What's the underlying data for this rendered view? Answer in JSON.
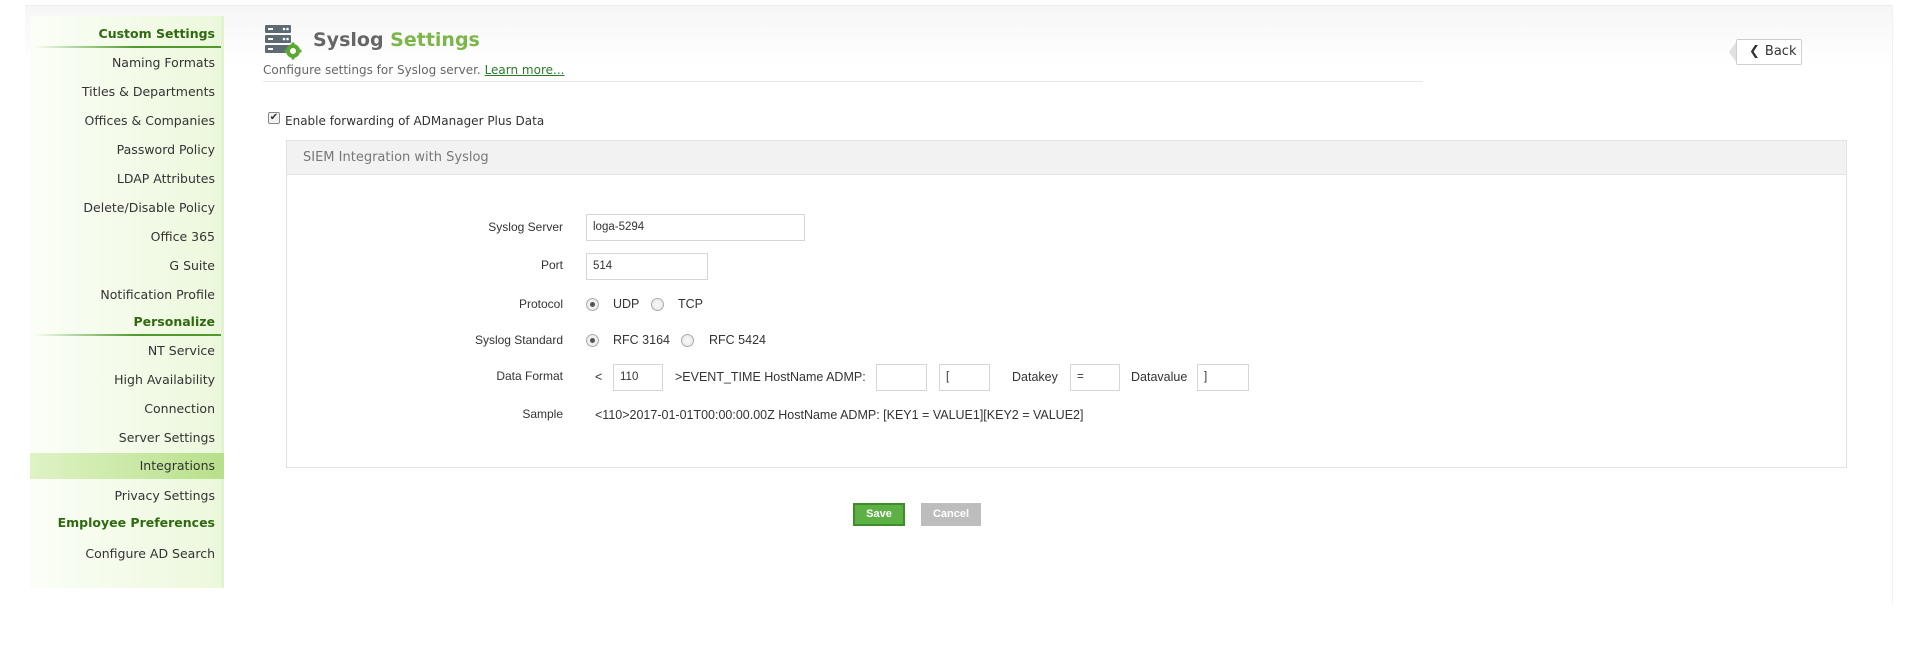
{
  "sidebar": {
    "sections": [
      {
        "heading": "Custom Settings",
        "items": [
          "Naming Formats",
          "Titles & Departments",
          "Offices & Companies",
          "Password Policy",
          "LDAP Attributes",
          "Delete/Disable Policy",
          "Office 365",
          "G Suite",
          "Notification Profile"
        ]
      },
      {
        "heading": "Personalize",
        "items": [
          "NT Service",
          "High Availability",
          "Connection",
          "Server Settings",
          "Integrations",
          "Privacy Settings"
        ]
      },
      {
        "heading": "Employee Preferences",
        "items": [
          "Configure AD Search"
        ]
      }
    ],
    "active_item": "Integrations",
    "accent_color": "#2f6a10"
  },
  "header": {
    "title_part1": "Syslog",
    "title_part2": "Settings",
    "description": "Configure settings for Syslog server.",
    "learn_more": "Learn more...",
    "back_label": "Back",
    "accent_color": "#7ab648"
  },
  "enable_forwarding": {
    "checked": true,
    "label": "Enable forwarding of ADManager Plus Data"
  },
  "panel": {
    "title": "SIEM Integration with Syslog",
    "syslog_server": {
      "label": "Syslog Server",
      "value": "loga-5294"
    },
    "port": {
      "label": "Port",
      "value": "514"
    },
    "protocol": {
      "label": "Protocol",
      "options": [
        "UDP",
        "TCP"
      ],
      "selected": "UDP"
    },
    "syslog_standard": {
      "label": "Syslog Standard",
      "options": [
        "RFC 3164",
        "RFC 5424"
      ],
      "selected": "RFC 3164"
    },
    "data_format": {
      "label": "Data Format",
      "prefix": "<",
      "priority": "110",
      "middle_text": ">EVENT_TIME HostName ADMP:",
      "field_blank": "",
      "field_bracket": "[",
      "datakey_label": "Datakey",
      "datakey_value": "=",
      "datavalue_label": "Datavalue",
      "datavalue_value": "]"
    },
    "sample": {
      "label": "Sample",
      "value": "<110>2017-01-01T00:00:00.00Z HostName ADMP: [KEY1 = VALUE1][KEY2 = VALUE2]"
    }
  },
  "actions": {
    "save_label": "Save",
    "cancel_label": "Cancel",
    "save_color": "#5db144"
  }
}
